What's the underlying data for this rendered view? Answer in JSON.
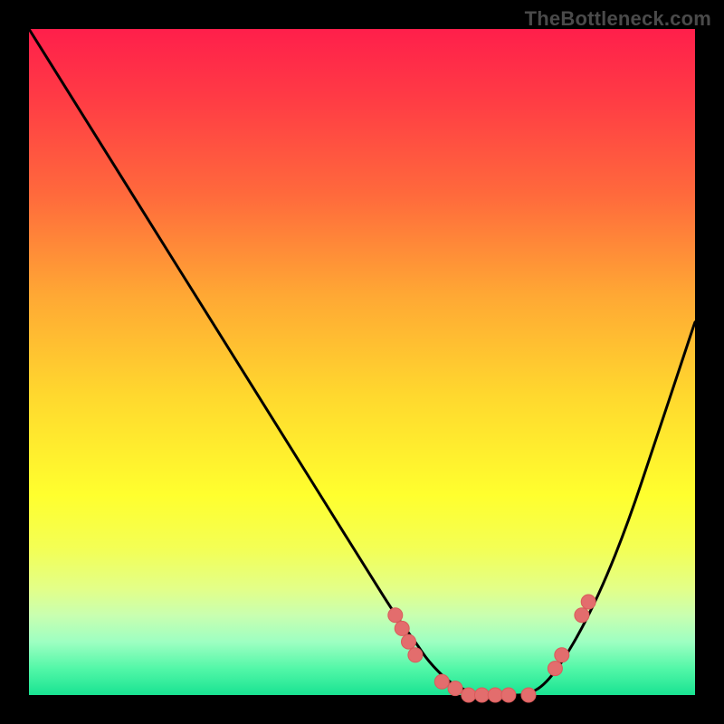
{
  "watermark": "TheBottleneck.com",
  "colors": {
    "background": "#000000",
    "dot": "#e36d6d",
    "curve": "#000000"
  },
  "chart_data": {
    "type": "line",
    "title": "",
    "xlabel": "",
    "ylabel": "",
    "xlim": [
      0,
      100
    ],
    "ylim": [
      0,
      100
    ],
    "x": [
      0,
      5,
      10,
      15,
      20,
      25,
      30,
      35,
      40,
      45,
      50,
      55,
      58,
      60,
      63,
      65,
      67,
      70,
      72,
      75,
      78,
      82,
      86,
      90,
      94,
      98,
      100
    ],
    "values": [
      100,
      92,
      84,
      76,
      68,
      60,
      52,
      44,
      36,
      28,
      20,
      12,
      8,
      5,
      2,
      1,
      0,
      0,
      0,
      0,
      2,
      8,
      16,
      26,
      38,
      50,
      56
    ],
    "markers": {
      "x": [
        55,
        56,
        57,
        58,
        62,
        64,
        66,
        68,
        70,
        72,
        75,
        79,
        80,
        83,
        84
      ],
      "y": [
        12,
        10,
        8,
        6,
        2,
        1,
        0,
        0,
        0,
        0,
        0,
        4,
        6,
        12,
        14
      ]
    },
    "gradient_stops": [
      {
        "pos": 0.0,
        "color": "#ff1f4b"
      },
      {
        "pos": 0.25,
        "color": "#ff6a3c"
      },
      {
        "pos": 0.55,
        "color": "#ffd82e"
      },
      {
        "pos": 0.78,
        "color": "#f3ff55"
      },
      {
        "pos": 0.92,
        "color": "#9effc2"
      },
      {
        "pos": 1.0,
        "color": "#19e392"
      }
    ]
  }
}
